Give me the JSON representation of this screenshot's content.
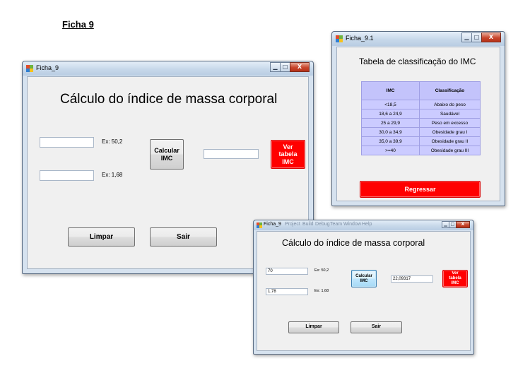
{
  "page": {
    "title": "Ficha 9"
  },
  "win1": {
    "title": "Ficha_9",
    "heading": "Cálculo do índice de massa corporal",
    "peso_value": "",
    "altura_value": "",
    "resultado_value": "",
    "peso_hint": "Ex: 50,2",
    "altura_hint": "Ex: 1,68",
    "calcular_label": "Calcular IMC",
    "ver_tabela_label": "Ver tabela IMC",
    "limpar_label": "Limpar",
    "sair_label": "Sair",
    "minimize": "▁",
    "maximize": "□",
    "close": "X"
  },
  "win2": {
    "title": "Ficha_9.1",
    "heading": "Tabela de classificação do IMC",
    "table": {
      "headers": [
        "IMC",
        "Classificação"
      ],
      "rows": [
        [
          "<18,5",
          "Abaixo do peso"
        ],
        [
          "18,6 a 24,9",
          "Saudável"
        ],
        [
          "25 a 29,9",
          "Peso em excesso"
        ],
        [
          "30,0 a 34,9",
          "Obesidade grau I"
        ],
        [
          "35,0 a 39,9",
          "Obesidade grau II"
        ],
        [
          ">=40",
          "Obesidade grau III"
        ]
      ]
    },
    "regressar_label": "Regressar",
    "minimize": "▁",
    "maximize": "□",
    "close": "X"
  },
  "win3": {
    "title": "Ficha_9",
    "menu_ghost": [
      "Project",
      "Build",
      "Debug",
      "Team",
      "Window",
      "Help"
    ],
    "heading": "Cálculo do índice de massa corporal",
    "peso_value": "70",
    "altura_value": "1,78",
    "resultado_value": "22,09317",
    "peso_hint": "Ex: 50,2",
    "altura_hint": "Ex: 1,68",
    "calcular_label": "Calcular IMC",
    "ver_tabela_label": "Ver tabela IMC",
    "limpar_label": "Limpar",
    "sair_label": "Sair",
    "minimize": "▁",
    "maximize": "□",
    "close": "X"
  },
  "colors": {
    "accent_red": "#ff0000",
    "table_fill": "#cbcbff",
    "form_background": "#f0f0f0"
  }
}
